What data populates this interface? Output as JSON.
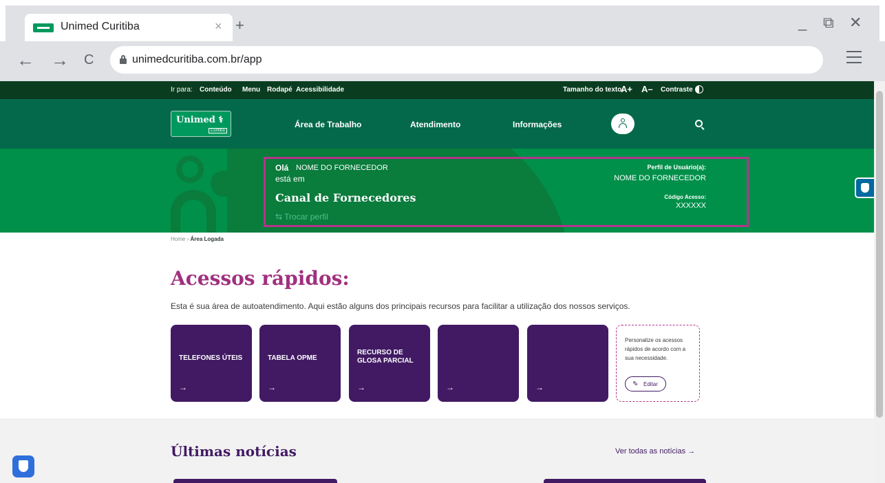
{
  "browser": {
    "tab_title": "Unimed Curitiba",
    "url": "unimedcuritiba.com.br/app",
    "close_glyph": "×",
    "new_tab_glyph": "+",
    "back_glyph": "←",
    "forward_glyph": "→",
    "reload_glyph": "C",
    "minimize_glyph": "_",
    "restore_glyph": "⧉",
    "close_window_glyph": "✕"
  },
  "topbar": {
    "ir_para": "Ir para:",
    "links": [
      "Conteúdo",
      "Menu",
      "Rodapé",
      "Acessibilidade"
    ],
    "tamanho": "Tamanho do texto:",
    "a_plus": "A+",
    "a_minus": "A–",
    "contraste": "Contraste"
  },
  "header": {
    "logo_main": "Unimed ⚕",
    "logo_sub": "Curitiba",
    "nav": [
      "Área de Trabalho",
      "Atendimento",
      "Informações"
    ]
  },
  "banner": {
    "ola": "Olá",
    "name": "NOME DO FORNECEDOR",
    "esta_em": "está em",
    "canal": "Canal de Fornecedores",
    "trocar": "⇆ Trocar perfil",
    "perfil_label": "Perfil de Usuário(a):",
    "perfil_value": "NOME DO FORNECEDOR",
    "codigo_label": "Código Acesso:",
    "codigo_value": "XXXXXX"
  },
  "breadcrumb": {
    "home": "Home",
    "sep": "›",
    "current": "Área Logada"
  },
  "acessos": {
    "title": "Acessos rápidos:",
    "description": "Esta é sua área de autoatendimento. Aqui estão alguns dos principais recursos para facilitar a utilização dos nossos serviços.",
    "cards": [
      "TELEFONES ÚTEIS",
      "TABELA OPME",
      "RECURSO DE\nGLOSA PARCIAL",
      "",
      ""
    ],
    "arrow": "→",
    "personalize": "Personalize os acessos rápidos de acordo com a sua necessidade.",
    "edit_label": "Editar"
  },
  "news": {
    "title": "Últimas notícias",
    "ver_todas": "Ver todas as notícias →"
  },
  "colors": {
    "primary_green": "#00904a",
    "dark_green": "#04694a",
    "purple": "#411a63",
    "magenta": "#a0307f"
  },
  "icons": [
    "lock-icon",
    "menu-icon",
    "contrast-icon",
    "user-icon",
    "search-icon",
    "libras-icon",
    "shield-icon",
    "pencil-icon"
  ]
}
